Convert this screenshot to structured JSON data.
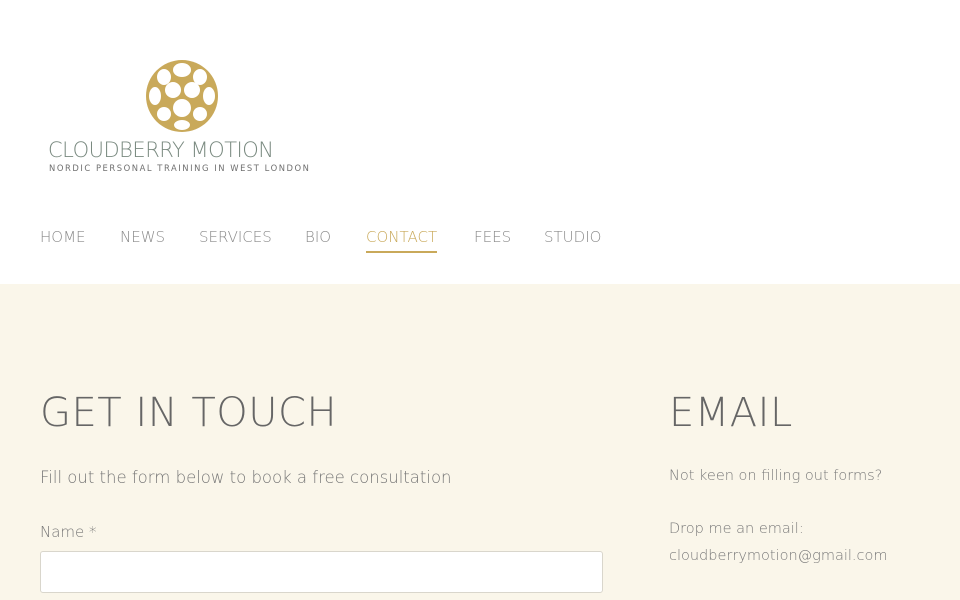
{
  "brand": {
    "name": "CLOUDBERRY MOTION",
    "tagline": "NORDIC PERSONAL TRAINING IN WEST LONDON",
    "accent_color": "#c9a95a",
    "mark_icon": "cloudberry-icon"
  },
  "nav": {
    "items": [
      {
        "label": "HOME"
      },
      {
        "label": "NEWS"
      },
      {
        "label": "SERVICES"
      },
      {
        "label": "BIO"
      },
      {
        "label": "CONTACT",
        "active": true
      },
      {
        "label": "FEES"
      },
      {
        "label": "STUDIO"
      }
    ]
  },
  "contact": {
    "heading": "GET IN TOUCH",
    "intro": "Fill out the form below to book a free consultation",
    "name_label": "Name *",
    "name_value": ""
  },
  "email": {
    "heading": "EMAIL",
    "line1": "Not keen on filling out forms?",
    "line2": "Drop me an email:",
    "address": "cloudberrymotion@gmail.com"
  }
}
